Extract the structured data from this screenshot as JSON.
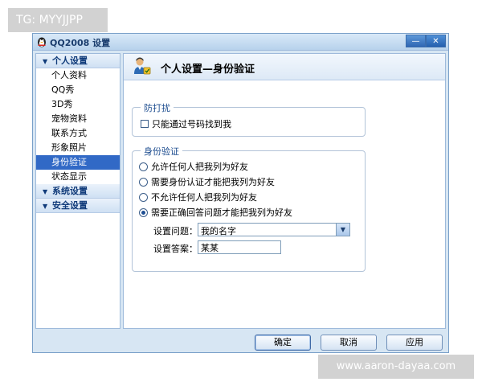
{
  "watermark_top": "TG: MYYJJPP",
  "watermark_bottom": "www.aaron-dayaa.com",
  "window": {
    "title": "QQ2008 设置",
    "minimize_label": "—",
    "close_label": "✕"
  },
  "sidebar": {
    "sections": [
      {
        "label": "个人设置",
        "expanded": true,
        "items": [
          {
            "label": "个人资料"
          },
          {
            "label": "QQ秀"
          },
          {
            "label": "3D秀"
          },
          {
            "label": "宠物资料"
          },
          {
            "label": "联系方式"
          },
          {
            "label": "形象照片"
          },
          {
            "label": "身份验证",
            "active": true
          },
          {
            "label": "状态显示"
          }
        ]
      },
      {
        "label": "系统设置",
        "expanded": false
      },
      {
        "label": "安全设置",
        "expanded": false
      }
    ]
  },
  "content": {
    "title": "个人设置—身份验证",
    "anti_disturb": {
      "legend": "防打扰",
      "checkbox_label": "只能通过号码找到我",
      "checked": false
    },
    "verification": {
      "legend": "身份验证",
      "options": [
        {
          "label": "允许任何人把我列为好友",
          "selected": false
        },
        {
          "label": "需要身份认证才能把我列为好友",
          "selected": false
        },
        {
          "label": "不允许任何人把我列为好友",
          "selected": false
        },
        {
          "label": "需要正确回答问题才能把我列为好友",
          "selected": true
        }
      ],
      "question_label": "设置问题：",
      "question_value": "我的名字",
      "answer_label": "设置答案：",
      "answer_value": "某某"
    }
  },
  "buttons": {
    "ok": "确定",
    "cancel": "取消",
    "apply": "应用"
  },
  "colors": {
    "window_bg": "#d7e6f3",
    "selection": "#3169c6",
    "section_text": "#103b7a"
  }
}
